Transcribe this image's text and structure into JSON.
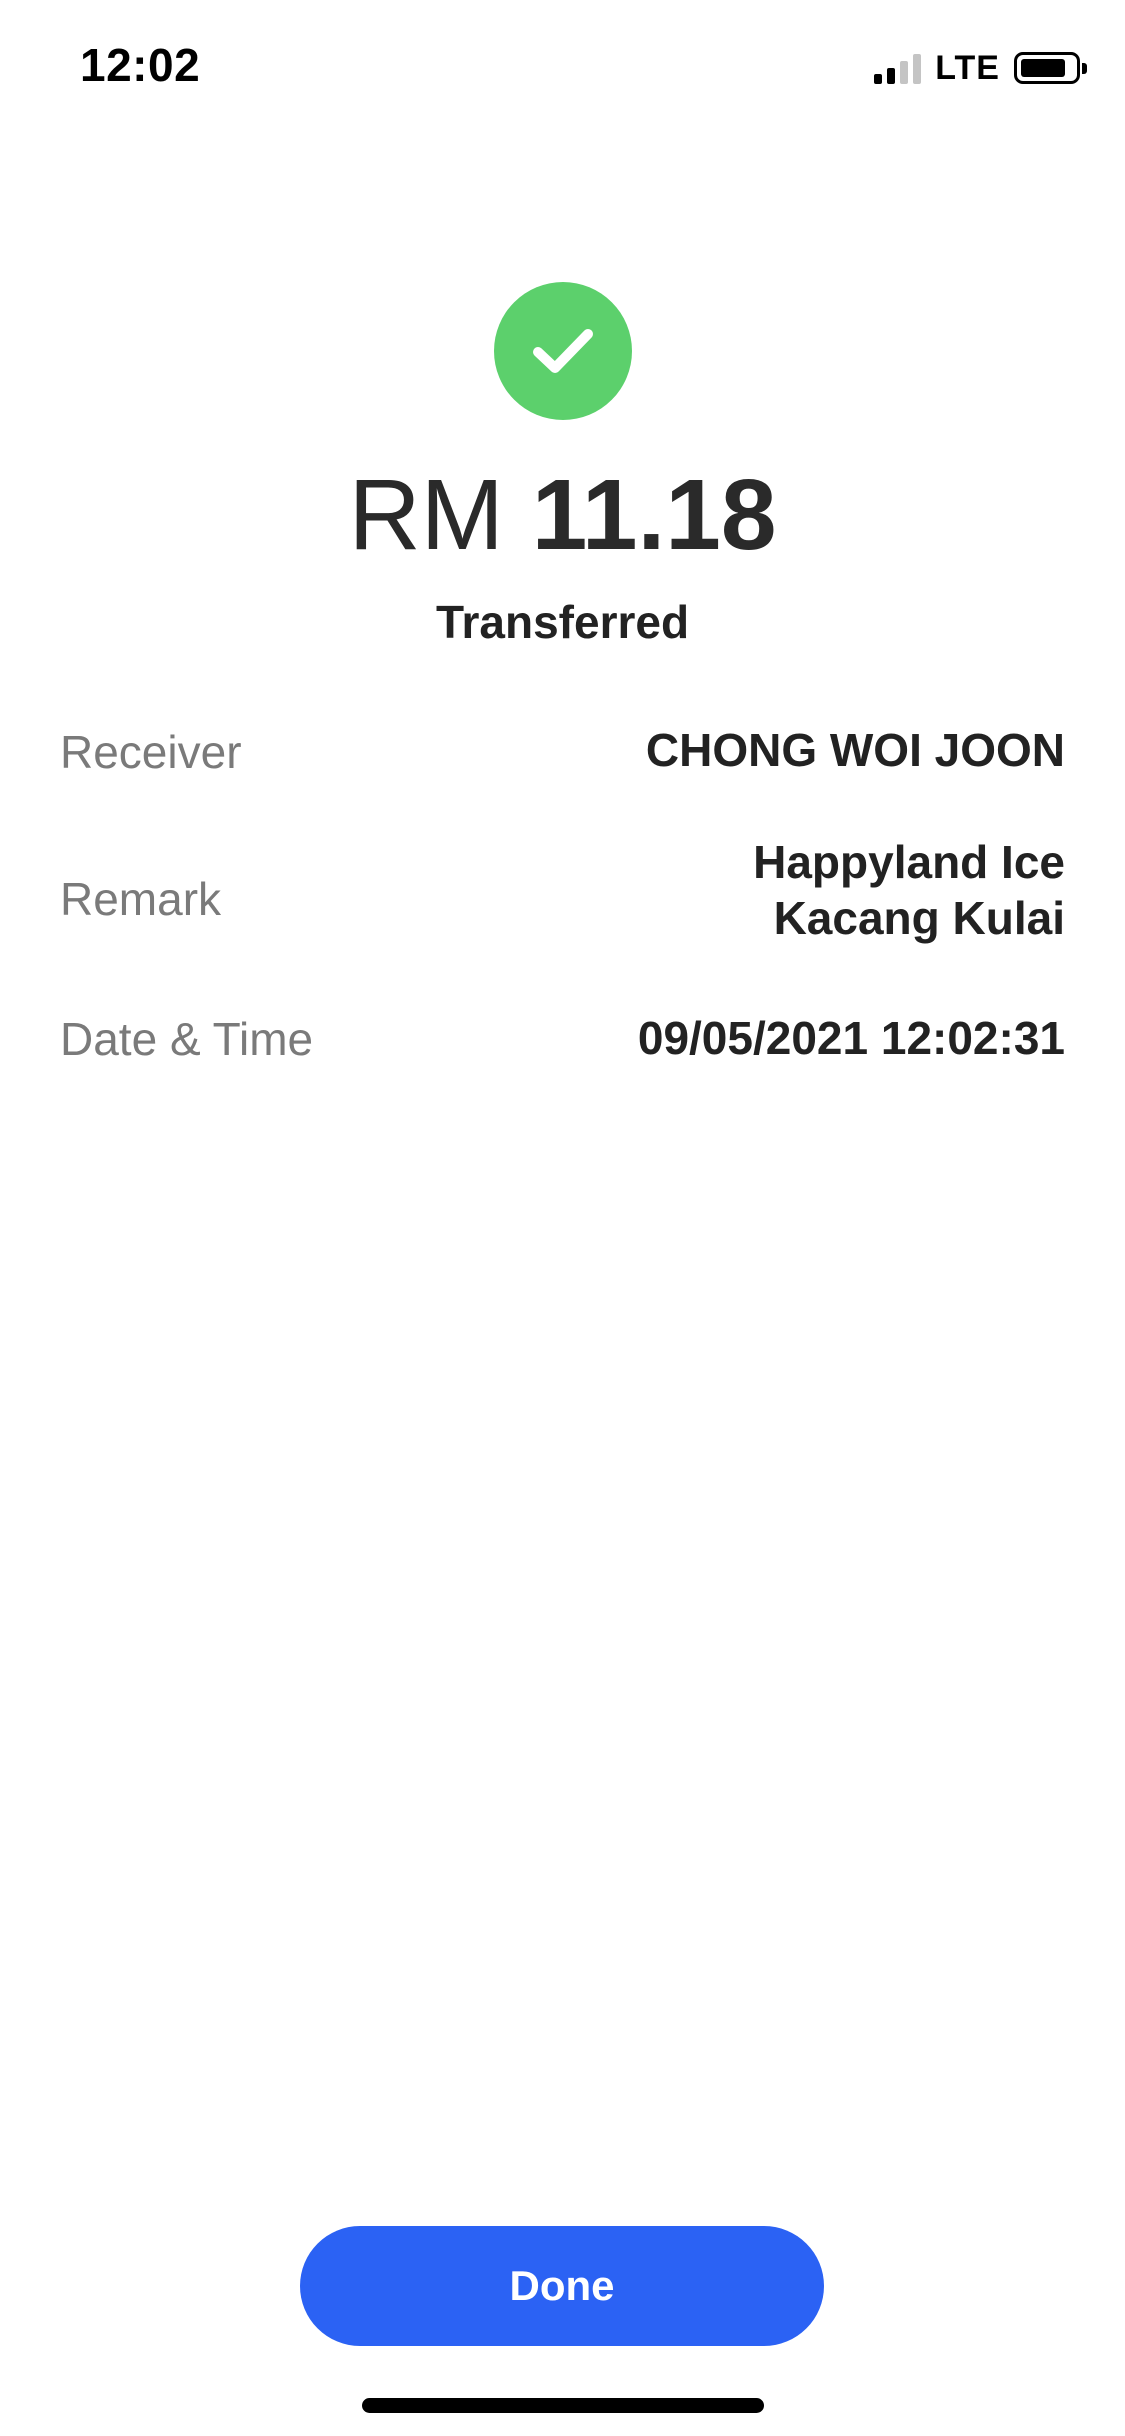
{
  "status_bar": {
    "time": "12:02",
    "network": "LTE",
    "icons": [
      "signal-icon",
      "battery-icon"
    ]
  },
  "receipt": {
    "success_icon": "checkmark-icon",
    "currency": "RM",
    "amount": "11.18",
    "status": "Transferred"
  },
  "details": {
    "receiver_label": "Receiver",
    "receiver_value": "CHONG WOI JOON",
    "remark_label": "Remark",
    "remark_line1": "Happyland Ice",
    "remark_line2": "Kacang Kulai",
    "datetime_label": "Date & Time",
    "datetime_value": "09/05/2021 12:02:31"
  },
  "actions": {
    "done_label": "Done"
  },
  "colors": {
    "success": "#5cd06c",
    "primary_button": "#2b62f4",
    "label_gray": "#7a7a7a",
    "text_dark": "#222222"
  }
}
